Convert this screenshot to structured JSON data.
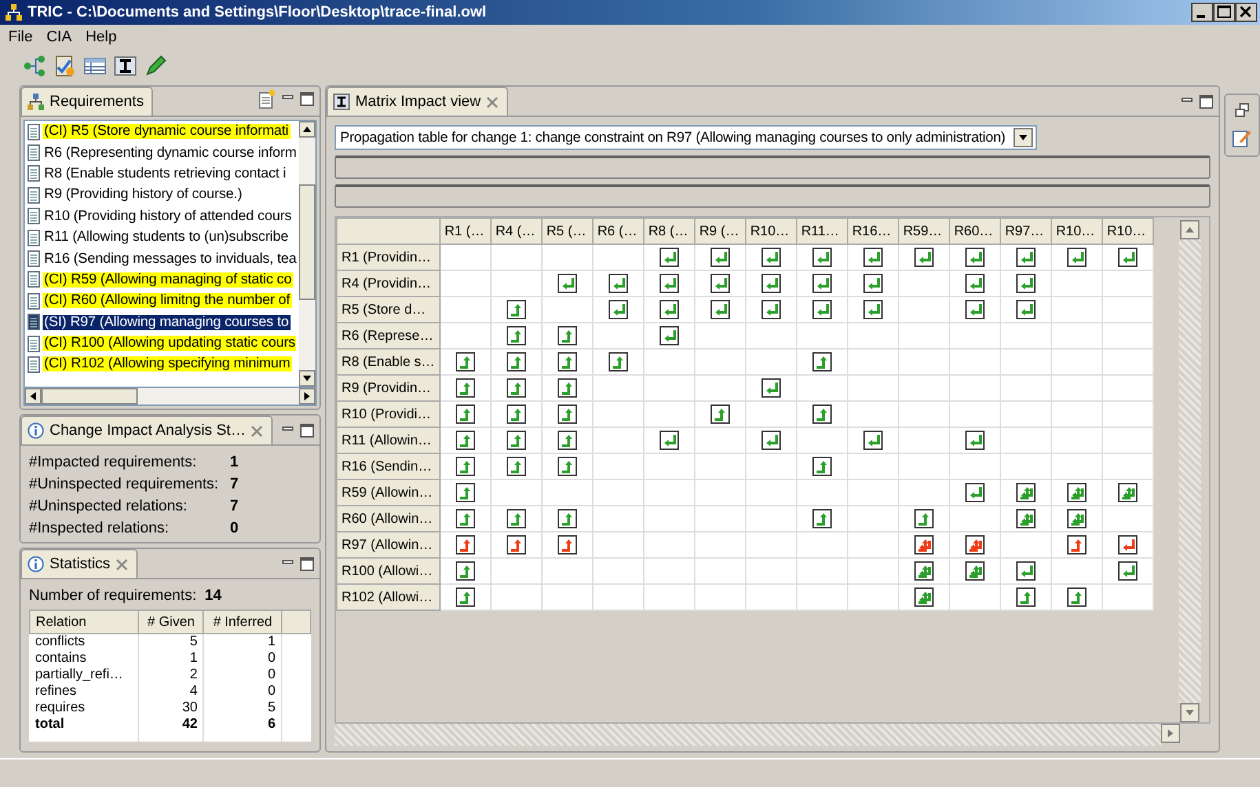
{
  "window": {
    "title": "TRIC - C:\\Documents and Settings\\Floor\\Desktop\\trace-final.owl"
  },
  "menu": [
    "File",
    "CIA",
    "Help"
  ],
  "requirements": {
    "tab": "Requirements",
    "items": [
      {
        "text": "(CI) R5 (Store dynamic course informati",
        "highlighted": true,
        "selected": false
      },
      {
        "text": "R6 (Representing dynamic course inform",
        "highlighted": false,
        "selected": false
      },
      {
        "text": "R8 (Enable students retrieving contact i",
        "highlighted": false,
        "selected": false
      },
      {
        "text": "R9 (Providing history of course.)",
        "highlighted": false,
        "selected": false
      },
      {
        "text": "R10 (Providing history of attended cours",
        "highlighted": false,
        "selected": false
      },
      {
        "text": "R11 (Allowing students to (un)subscribe",
        "highlighted": false,
        "selected": false
      },
      {
        "text": "R16 (Sending messages to inviduals, tea",
        "highlighted": false,
        "selected": false
      },
      {
        "text": "(CI) R59 (Allowing managing of static co",
        "highlighted": true,
        "selected": false
      },
      {
        "text": "(CI) R60 (Allowing limitng the number of",
        "highlighted": true,
        "selected": false
      },
      {
        "text": "(SI) R97 (Allowing managing courses to",
        "highlighted": false,
        "selected": true
      },
      {
        "text": "(CI) R100 (Allowing updating static cours",
        "highlighted": true,
        "selected": false
      },
      {
        "text": "(CI) R102 (Allowing specifying minimum",
        "highlighted": true,
        "selected": false
      }
    ]
  },
  "cia": {
    "tab": "Change Impact Analysis St…",
    "rows": [
      {
        "label": "#Impacted requirements:",
        "value": "1"
      },
      {
        "label": "#Uninspected requirements:",
        "value": "7"
      },
      {
        "label": "#Uninspected relations:",
        "value": "7"
      },
      {
        "label": "#Inspected relations:",
        "value": "0"
      }
    ]
  },
  "statistics": {
    "tab": "Statistics",
    "count_label": "Number of requirements:",
    "count": "14",
    "columns": [
      "Relation",
      "# Given",
      "# Inferred"
    ],
    "rows": [
      {
        "relation": "conflicts",
        "given": "5",
        "inferred": "1",
        "total": false
      },
      {
        "relation": "contains",
        "given": "1",
        "inferred": "0",
        "total": false
      },
      {
        "relation": "partially_refi…",
        "given": "2",
        "inferred": "0",
        "total": false
      },
      {
        "relation": "refines",
        "given": "4",
        "inferred": "0",
        "total": false
      },
      {
        "relation": "requires",
        "given": "30",
        "inferred": "5",
        "total": false
      },
      {
        "relation": "total",
        "given": "42",
        "inferred": "6",
        "total": true
      }
    ]
  },
  "matrix": {
    "tab": "Matrix Impact view",
    "selector": "Propagation table for change 1: change constraint on R97 (Allowing managing courses to only administration)",
    "columns": [
      "R1 (…",
      "R4 (…",
      "R5 (…",
      "R6 (…",
      "R8 (…",
      "R9 (…",
      "R10…",
      "R11…",
      "R16…",
      "R59…",
      "R60…",
      "R97…",
      "R10…",
      "R10…"
    ],
    "rows": [
      {
        "label": "R1 (Providin…",
        "cells": [
          null,
          null,
          null,
          null,
          {
            "kind": "down",
            "impacted": false
          },
          {
            "kind": "down",
            "impacted": false
          },
          {
            "kind": "down",
            "impacted": false
          },
          {
            "kind": "down",
            "impacted": false
          },
          {
            "kind": "down",
            "impacted": false
          },
          {
            "kind": "down",
            "impacted": false
          },
          {
            "kind": "down",
            "impacted": false
          },
          {
            "kind": "down",
            "impacted": false
          },
          {
            "kind": "down",
            "impacted": false
          },
          {
            "kind": "down",
            "impacted": false
          }
        ]
      },
      {
        "label": "R4 (Providin…",
        "cells": [
          null,
          null,
          {
            "kind": "down",
            "impacted": false
          },
          {
            "kind": "down",
            "impacted": false
          },
          {
            "kind": "down",
            "impacted": false
          },
          {
            "kind": "down",
            "impacted": false
          },
          {
            "kind": "down",
            "impacted": false
          },
          {
            "kind": "down",
            "impacted": false
          },
          {
            "kind": "down",
            "impacted": false
          },
          null,
          {
            "kind": "down",
            "impacted": false
          },
          {
            "kind": "down",
            "impacted": false
          },
          null,
          null
        ]
      },
      {
        "label": "R5 (Store d…",
        "cells": [
          null,
          {
            "kind": "up",
            "impacted": false
          },
          null,
          {
            "kind": "down",
            "impacted": false
          },
          {
            "kind": "down",
            "impacted": false
          },
          {
            "kind": "down",
            "impacted": false
          },
          {
            "kind": "down",
            "impacted": false
          },
          {
            "kind": "down",
            "impacted": false
          },
          {
            "kind": "down",
            "impacted": false
          },
          null,
          {
            "kind": "down",
            "impacted": false
          },
          {
            "kind": "down",
            "impacted": false
          },
          null,
          null
        ]
      },
      {
        "label": "R6 (Represe…",
        "cells": [
          null,
          {
            "kind": "up",
            "impacted": false
          },
          {
            "kind": "up",
            "impacted": false
          },
          null,
          {
            "kind": "down",
            "impacted": false
          },
          null,
          null,
          null,
          null,
          null,
          null,
          null,
          null,
          null
        ]
      },
      {
        "label": "R8 (Enable s…",
        "cells": [
          {
            "kind": "up",
            "impacted": false
          },
          {
            "kind": "up",
            "impacted": false
          },
          {
            "kind": "up",
            "impacted": false
          },
          {
            "kind": "up",
            "impacted": false
          },
          null,
          null,
          null,
          {
            "kind": "up",
            "impacted": false
          },
          null,
          null,
          null,
          null,
          null,
          null
        ]
      },
      {
        "label": "R9 (Providin…",
        "cells": [
          {
            "kind": "up",
            "impacted": false
          },
          {
            "kind": "up",
            "impacted": false
          },
          {
            "kind": "up",
            "impacted": false
          },
          null,
          null,
          null,
          {
            "kind": "down",
            "impacted": false
          },
          null,
          null,
          null,
          null,
          null,
          null,
          null
        ]
      },
      {
        "label": "R10 (Providi…",
        "cells": [
          {
            "kind": "up",
            "impacted": false
          },
          {
            "kind": "up",
            "impacted": false
          },
          {
            "kind": "up",
            "impacted": false
          },
          null,
          null,
          {
            "kind": "up",
            "impacted": false
          },
          null,
          {
            "kind": "up",
            "impacted": false
          },
          null,
          null,
          null,
          null,
          null,
          null
        ]
      },
      {
        "label": "R11 (Allowin…",
        "cells": [
          {
            "kind": "up",
            "impacted": false
          },
          {
            "kind": "up",
            "impacted": false
          },
          {
            "kind": "up",
            "impacted": false
          },
          null,
          {
            "kind": "down",
            "impacted": false
          },
          null,
          {
            "kind": "down",
            "impacted": false
          },
          null,
          {
            "kind": "down",
            "impacted": false
          },
          null,
          {
            "kind": "down",
            "impacted": false
          },
          null,
          null,
          null
        ]
      },
      {
        "label": "R16 (Sendin…",
        "cells": [
          {
            "kind": "up",
            "impacted": false
          },
          {
            "kind": "up",
            "impacted": false
          },
          {
            "kind": "up",
            "impacted": false
          },
          null,
          null,
          null,
          null,
          {
            "kind": "up",
            "impacted": false
          },
          null,
          null,
          null,
          null,
          null,
          null
        ]
      },
      {
        "label": "R59 (Allowin…",
        "cells": [
          {
            "kind": "up",
            "impacted": false
          },
          null,
          null,
          null,
          null,
          null,
          null,
          null,
          null,
          null,
          {
            "kind": "down",
            "impacted": false
          },
          {
            "kind": "both",
            "impacted": false
          },
          {
            "kind": "both",
            "impacted": false
          },
          {
            "kind": "both",
            "impacted": false
          }
        ]
      },
      {
        "label": "R60 (Allowin…",
        "cells": [
          {
            "kind": "up",
            "impacted": false
          },
          {
            "kind": "up",
            "impacted": false
          },
          {
            "kind": "up",
            "impacted": false
          },
          null,
          null,
          null,
          null,
          {
            "kind": "up",
            "impacted": false
          },
          null,
          {
            "kind": "up",
            "impacted": false
          },
          null,
          {
            "kind": "both",
            "impacted": false
          },
          {
            "kind": "both",
            "impacted": false
          },
          null
        ]
      },
      {
        "label": "R97 (Allowin…",
        "cells": [
          {
            "kind": "up",
            "impacted": true
          },
          {
            "kind": "up",
            "impacted": true
          },
          {
            "kind": "up",
            "impacted": true
          },
          null,
          null,
          null,
          null,
          null,
          null,
          {
            "kind": "both",
            "impacted": true
          },
          {
            "kind": "both",
            "impacted": true
          },
          null,
          {
            "kind": "up",
            "impacted": true
          },
          {
            "kind": "down",
            "impacted": true
          }
        ]
      },
      {
        "label": "R100 (Allowi…",
        "cells": [
          {
            "kind": "up",
            "impacted": false
          },
          null,
          null,
          null,
          null,
          null,
          null,
          null,
          null,
          {
            "kind": "both",
            "impacted": false
          },
          {
            "kind": "both",
            "impacted": false
          },
          {
            "kind": "down",
            "impacted": false
          },
          null,
          {
            "kind": "down",
            "impacted": false
          }
        ]
      },
      {
        "label": "R102 (Allowi…",
        "cells": [
          {
            "kind": "up",
            "impacted": false
          },
          null,
          null,
          null,
          null,
          null,
          null,
          null,
          null,
          {
            "kind": "both",
            "impacted": false
          },
          null,
          {
            "kind": "up",
            "impacted": false
          },
          {
            "kind": "up",
            "impacted": false
          },
          null
        ]
      }
    ]
  }
}
